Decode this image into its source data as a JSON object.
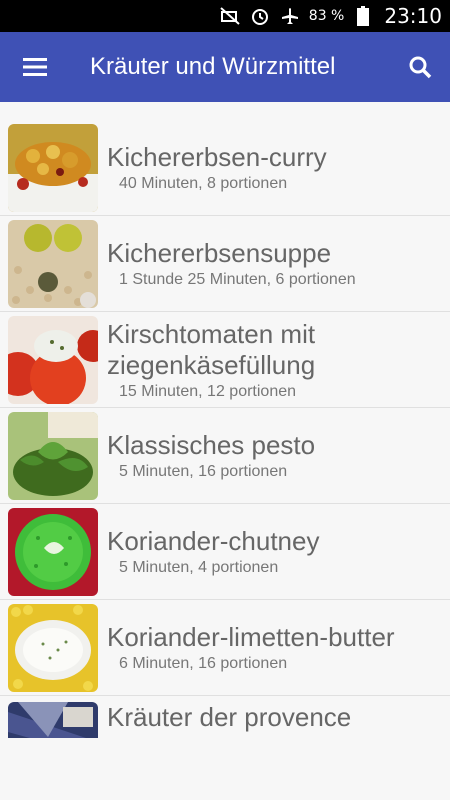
{
  "status_bar": {
    "icons": [
      "mute-icon",
      "alarm-icon",
      "airplane-icon",
      "battery-icon"
    ],
    "battery_percent": "83 %",
    "time": "23:10"
  },
  "app_bar": {
    "title": "Kräuter und Würzmittel",
    "color": "#3f51b5",
    "icons": [
      "hamburger-menu-icon",
      "search-icon"
    ]
  },
  "recipes": [
    {
      "name": "Kichererbsen-curry",
      "meta": "40 Minuten, 8 portionen"
    },
    {
      "name": "Kichererbsensuppe",
      "meta": "1 Stunde 25 Minuten, 6 portionen"
    },
    {
      "name": "Kirschtomaten mit ziegenkäsefüllung",
      "meta": "15 Minuten, 12 portionen"
    },
    {
      "name": "Klassisches pesto",
      "meta": "5 Minuten, 16 portionen"
    },
    {
      "name": "Koriander-chutney",
      "meta": "5 Minuten, 4 portionen"
    },
    {
      "name": "Koriander-limetten-butter",
      "meta": "6 Minuten, 16 portionen"
    },
    {
      "name": "Kräuter der provence",
      "meta": ""
    }
  ]
}
